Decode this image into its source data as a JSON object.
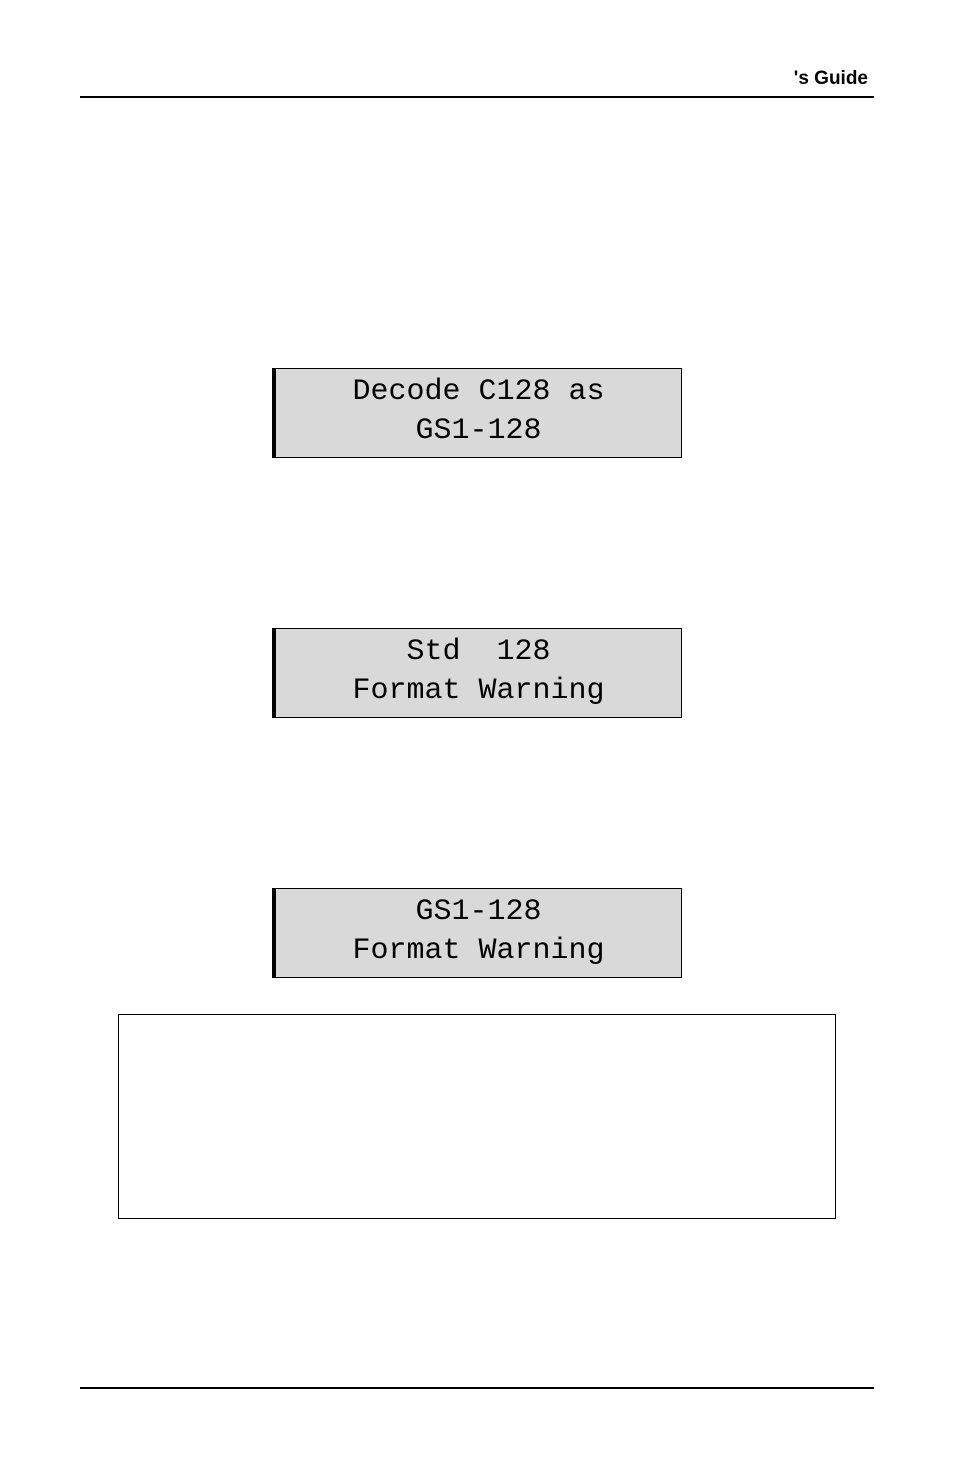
{
  "header": {
    "right_text": "'s Guide"
  },
  "lcd": {
    "box1_line1": "Decode C128 as",
    "box1_line2": "GS1-128",
    "box2_line1": "Std  128",
    "box2_line2": "Format Warning",
    "box3_line1": "GS1-128",
    "box3_line2": "Format Warning"
  }
}
